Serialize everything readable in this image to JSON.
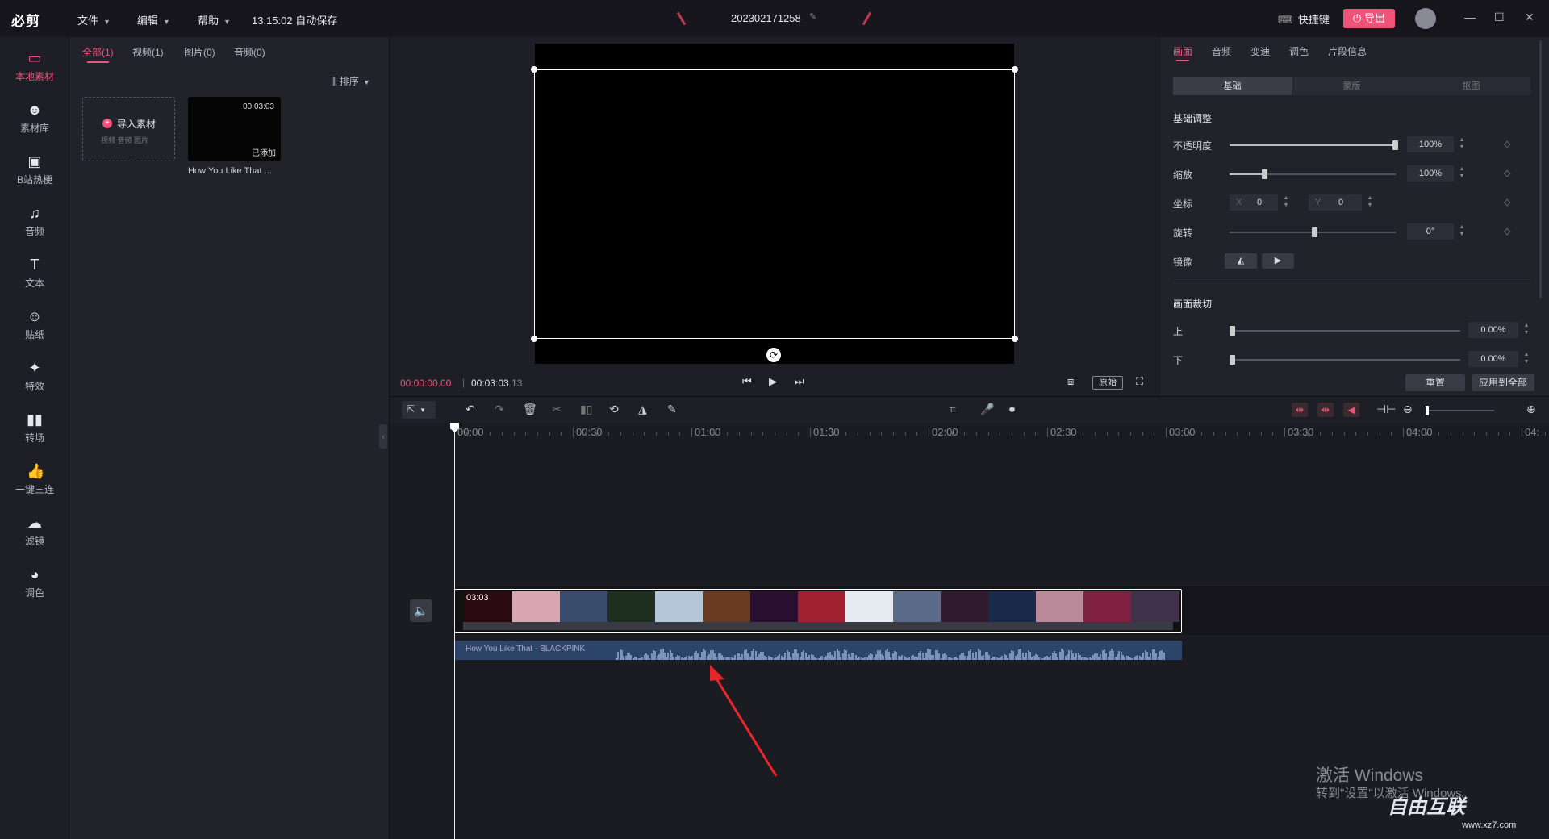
{
  "titlebar": {
    "logo": "必剪",
    "menu": [
      "文件",
      "编辑",
      "帮助"
    ],
    "autosave": "13:15:02 自动保存",
    "project_name": "202302171258",
    "shortcut_label": "快捷键",
    "export_label": "导出"
  },
  "leftnav": [
    {
      "label": "本地素材",
      "icon": "folder"
    },
    {
      "label": "素材库",
      "icon": "face"
    },
    {
      "label": "B站热梗",
      "icon": "tv"
    },
    {
      "label": "音频",
      "icon": "music-note"
    },
    {
      "label": "文本",
      "icon": "text-T"
    },
    {
      "label": "贴纸",
      "icon": "sticker"
    },
    {
      "label": "特效",
      "icon": "star"
    },
    {
      "label": "转场",
      "icon": "transition"
    },
    {
      "label": "一键三连",
      "icon": "thumbs-up"
    },
    {
      "label": "滤镜",
      "icon": "filter"
    },
    {
      "label": "调色",
      "icon": "palette"
    }
  ],
  "media": {
    "tabs": [
      "全部(1)",
      "视频(1)",
      "图片(0)",
      "音频(0)"
    ],
    "sort_label": "排序",
    "import_label": "导入素材",
    "import_hint": "视频  音频  图片",
    "clip": {
      "duration": "00:03:03",
      "status": "已添加",
      "name": "How You Like That ..."
    }
  },
  "preview": {
    "current_time": "00:00:00.00",
    "total_time": "00:03:03",
    "total_frames": ".13",
    "ratio_label": "原始"
  },
  "props": {
    "tabs": [
      "画面",
      "音频",
      "变速",
      "调色",
      "片段信息"
    ],
    "subtabs": [
      "基础",
      "蒙版",
      "抠图"
    ],
    "section_basic": "基础调整",
    "opacity_label": "不透明度",
    "opacity_value": "100%",
    "scale_label": "缩放",
    "scale_value": "100%",
    "position_label": "坐标",
    "x_prefix": "X",
    "x_value": "0",
    "y_prefix": "Y",
    "y_value": "0",
    "rotate_label": "旋转",
    "rotate_value": "0°",
    "mirror_label": "镜像",
    "section_crop": "画面裁切",
    "crop_top_label": "上",
    "crop_top_value": "0.00%",
    "crop_bottom_label": "下",
    "crop_bottom_value": "0.00%",
    "reset_label": "重置",
    "apply_all_label": "应用到全部"
  },
  "timeline": {
    "ticks": [
      "00:00",
      "00:30",
      "01:00",
      "01:30",
      "02:00",
      "02:30",
      "03:00",
      "03:30",
      "04:00",
      "04:"
    ],
    "video_clip_duration": "03:03",
    "audio_clip_name": "How You Like That - BLACKPINK"
  },
  "watermark": {
    "line1": "激活 Windows",
    "line2": "转到\"设置\"以激活 Windows。",
    "logo": "自由互联",
    "url": "www.xz7.com"
  },
  "colors": {
    "accent": "#f0527a",
    "panel": "#22222b",
    "audio": "#2b4468"
  }
}
